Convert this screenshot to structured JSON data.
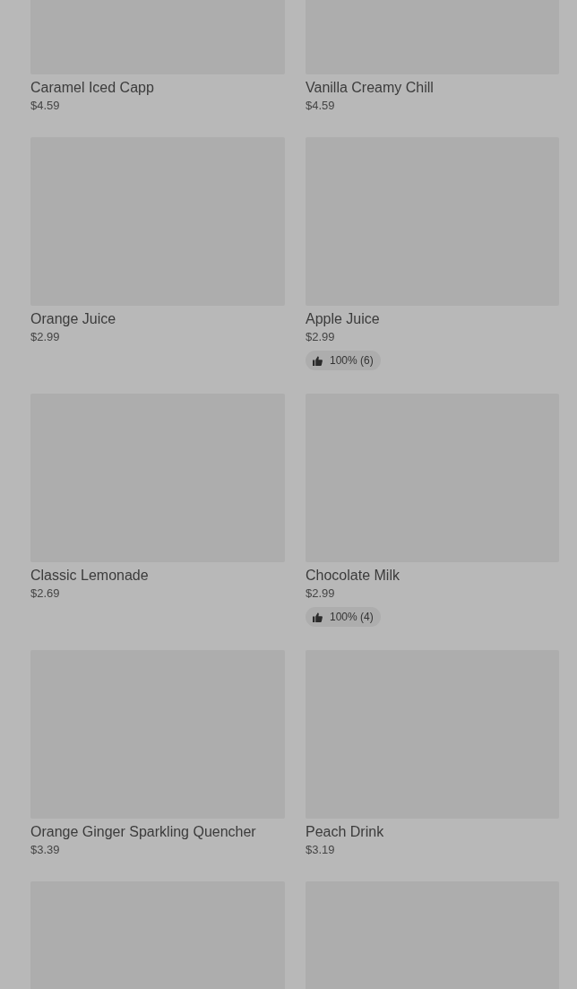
{
  "products": [
    {
      "kind": "product",
      "name": "Caramel Iced Capp",
      "price": "$4.59"
    },
    {
      "kind": "product",
      "name": "Vanilla Creamy Chill",
      "price": "$4.59"
    },
    {
      "kind": "product",
      "name": "Orange Juice",
      "price": "$2.99"
    },
    {
      "kind": "product",
      "name": "Apple Juice",
      "price": "$2.99",
      "rating": "100% (6)"
    },
    {
      "kind": "product",
      "name": "Classic Lemonade",
      "price": "$2.69"
    },
    {
      "kind": "product",
      "name": "Chocolate Milk",
      "price": "$2.99",
      "rating": "100% (4)"
    },
    {
      "kind": "product",
      "name": "Orange Ginger Sparkling Quencher",
      "price": "$3.39"
    },
    {
      "kind": "product",
      "name": "Peach Drink",
      "price": "$3.19"
    },
    {
      "kind": "picture"
    },
    {
      "kind": "picture"
    }
  ]
}
